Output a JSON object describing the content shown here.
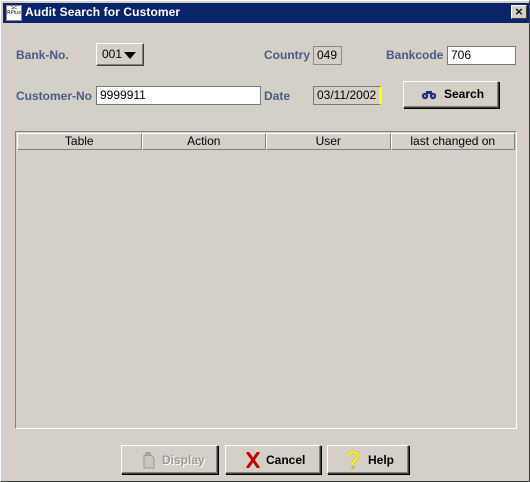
{
  "window": {
    "title": "Audit Search for Customer",
    "app_icon_text": "Sc RPlus",
    "close_glyph": "×"
  },
  "form": {
    "bank_no_label": "Bank-No.",
    "bank_no_value": "001",
    "country_label": "Country",
    "country_value": "049",
    "bankcode_label": "Bankcode",
    "bankcode_value": "706",
    "customer_no_label": "Customer-No",
    "customer_no_value": "9999911",
    "date_label": "Date",
    "date_value": "03/11/2002",
    "search_button": "Search"
  },
  "table": {
    "columns": [
      "Table",
      "Action",
      "User",
      "last changed on"
    ],
    "rows": []
  },
  "footer": {
    "display_button": "Display",
    "cancel_button": "Cancel",
    "help_button": "Help"
  },
  "colors": {
    "title_bar": "#0a246a",
    "label_text": "#4a5a8a",
    "window_bg": "#d4d0c8",
    "date_highlight": "#ffff00"
  },
  "icons": {
    "search": "binoculars-icon",
    "display": "document-icon",
    "cancel": "red-x-icon",
    "help": "question-mark-icon"
  }
}
